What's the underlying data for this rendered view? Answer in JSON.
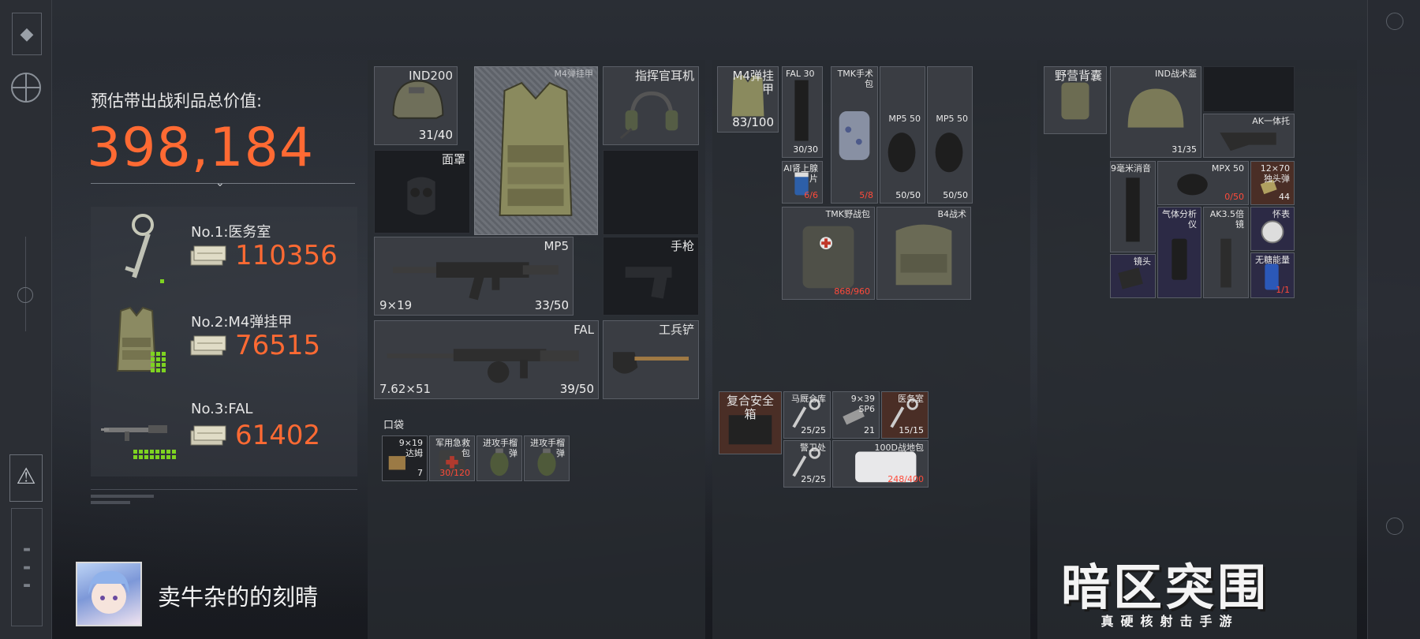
{
  "summary": {
    "total_label": "预估带出战利品总价值:",
    "total_value": "398,184",
    "top_items": [
      {
        "name": "No.1:医务室",
        "value": "110356"
      },
      {
        "name": "No.2:M4弹挂甲",
        "value": "76515"
      },
      {
        "name": "No.3:FAL",
        "value": "61402"
      }
    ]
  },
  "player": {
    "name": "卖牛杂的的刻晴"
  },
  "gear": {
    "helmet": {
      "name": "IND200",
      "durability": "31/40"
    },
    "vest": {
      "name": "M4弹挂甲"
    },
    "headset": {
      "name": "指挥官耳机"
    },
    "mask": {
      "name": "面罩"
    },
    "primary": {
      "name": "MP5",
      "ammo_type": "9×19",
      "ammo": "33/50"
    },
    "pistol": {
      "name": "手枪"
    },
    "secondary": {
      "name": "FAL",
      "ammo_type": "7.62×51",
      "ammo": "39/50"
    },
    "melee": {
      "name": "工兵铲"
    },
    "pocket_label": "口袋",
    "pockets": [
      {
        "name": "9×19\n达姆",
        "count": "7"
      },
      {
        "name": "军用急救\n包",
        "count": "30/120"
      },
      {
        "name": "进攻手榴\n弹",
        "count": ""
      },
      {
        "name": "进攻手榴\n弹",
        "count": ""
      }
    ]
  },
  "rig": {
    "vest_name": "M4弹挂\n甲",
    "vest_durability": "83/100",
    "items": [
      {
        "name": "FAL 30",
        "count": "30/30"
      },
      {
        "name": "TMK手术\n包",
        "count": "5/8"
      },
      {
        "name": "MP5 50",
        "count": "50/50"
      },
      {
        "name": "MP5 50",
        "count": "50/50"
      },
      {
        "name": "AI肾上腺片",
        "count": "6/6"
      },
      {
        "name": "TMK野战包",
        "count": "868/960"
      },
      {
        "name": "B4战术",
        "count": ""
      }
    ],
    "safebox_label": "复合安全\n箱",
    "safebox_items": [
      {
        "name": "马厩仓库",
        "count": "25/25"
      },
      {
        "name": "9×39\nSP6",
        "count": "21"
      },
      {
        "name": "医务室",
        "count": "15/15"
      },
      {
        "name": "警卫处",
        "count": "25/25"
      },
      {
        "name": "100D战地包",
        "count": "248/400"
      }
    ]
  },
  "backpack": {
    "name": "野营背囊",
    "items": [
      {
        "name": "IND战术盔",
        "count": "31/35"
      },
      {
        "name": "AK一体托",
        "count": ""
      },
      {
        "name": "9毫米消音",
        "count": ""
      },
      {
        "name": "MPX 50",
        "count": "0/50"
      },
      {
        "name": "12×70\n独头弹",
        "count": "44"
      },
      {
        "name": "气体分析\n仪",
        "count": ""
      },
      {
        "name": "AK3.5倍\n镜",
        "count": ""
      },
      {
        "name": "怀表",
        "count": ""
      },
      {
        "name": "镜头",
        "count": ""
      },
      {
        "name": "无糖能量",
        "count": "1/1"
      }
    ]
  },
  "brand": {
    "title": "暗区突围",
    "subtitle": "真硬核射击手游"
  },
  "colors": {
    "accent": "#ff6a33",
    "durability_low": "#ff4a3a",
    "value_grid": "#7ed321"
  }
}
